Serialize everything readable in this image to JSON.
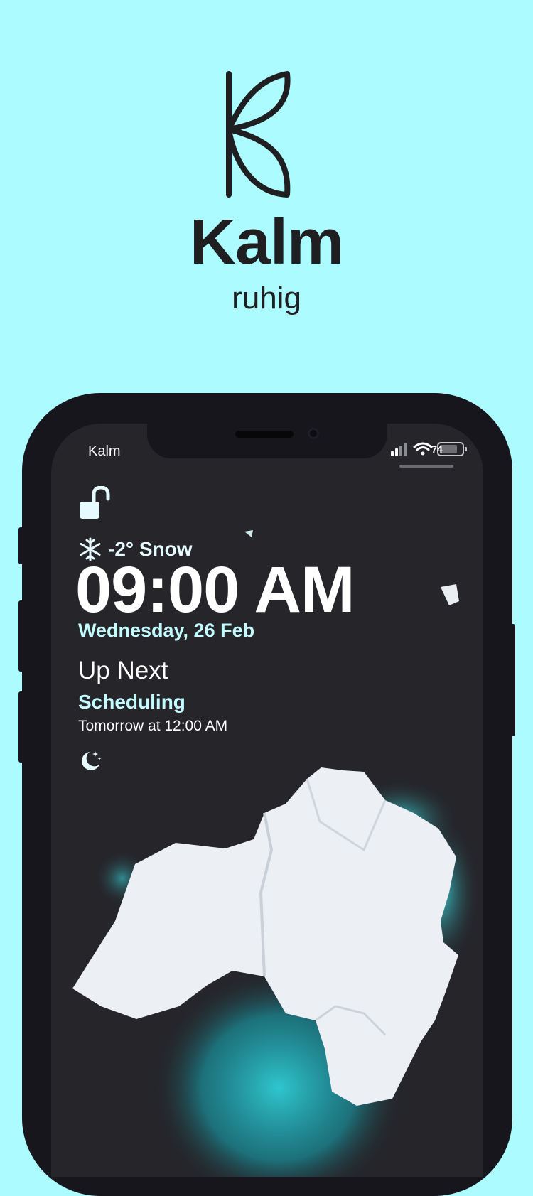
{
  "brand": {
    "name": "Kalm",
    "tagline": "ruhig",
    "background_color": "#abfbff",
    "logo_icon": "leaf-k-logo-icon"
  },
  "status_bar": {
    "carrier": "Kalm",
    "battery": "74",
    "icons": [
      "signal-icon",
      "wifi-icon",
      "battery-icon"
    ]
  },
  "lock_screen": {
    "lock_icon": "unlocked-padlock-icon",
    "weather": {
      "icon": "snowflake-icon",
      "text": "-2° Snow"
    },
    "time": "09:00 AM",
    "date": "Wednesday, 26 Feb",
    "up_next": {
      "heading": "Up Next",
      "title": "Scheduling",
      "time": "Tomorrow at 12:00 AM"
    },
    "focus_icon": "moon-stars-icon",
    "accent_color": "#c3fbff"
  }
}
